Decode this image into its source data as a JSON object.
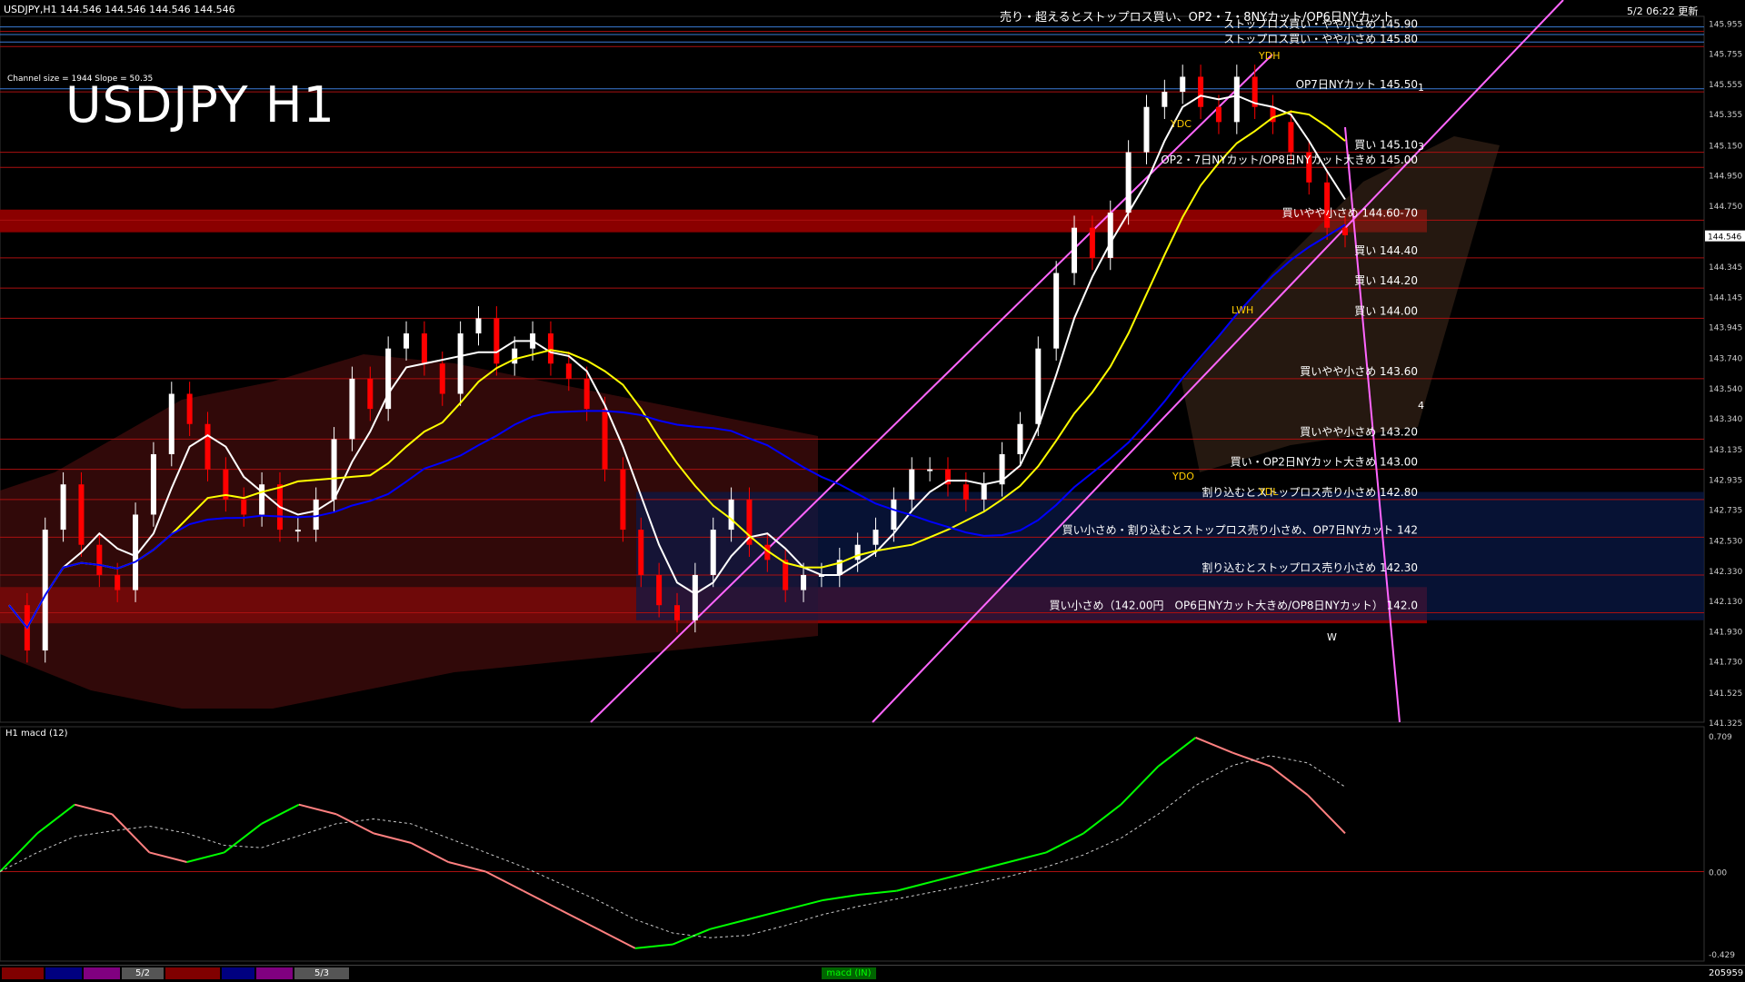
{
  "header": {
    "symbol_line": "USDJPY,H1  144.546 144.546 144.546 144.546",
    "datetime": "5/2 06:22 更新",
    "channel_info": "Channel size = 1944 Slope = 50.35",
    "chart_title": "USDJPY H1",
    "macd_label": "H1  macd (12)"
  },
  "colors": {
    "background": "#000000",
    "up_candle": "#ffffff",
    "down_candle": "#ff0000",
    "sma_short": "#ffffff",
    "sma_mid": "#ffff00",
    "sma_long": "#0000ff",
    "macd_up": "#00ff00",
    "macd_down": "#ff8080",
    "channel": "#ff66ff",
    "zone": "#8b0000"
  },
  "chart_data": {
    "type": "candlestick",
    "price_axis": {
      "min": 141.325,
      "max": 146.0,
      "ticks": [
        "145.955",
        "145.755",
        "145.555",
        "145.355",
        "145.150",
        "144.950",
        "144.750",
        "144.546",
        "144.345",
        "144.145",
        "143.945",
        "143.740",
        "143.540",
        "143.340",
        "143.135",
        "142.935",
        "142.735",
        "142.530",
        "142.330",
        "142.130",
        "141.930",
        "141.730",
        "141.525",
        "141.325"
      ],
      "current_price": "144.546"
    },
    "levels": [
      {
        "price": 145.9,
        "label": "ストップロス買い・やや小さめ 145.90"
      },
      {
        "price": 145.8,
        "label": "ストップロス買い・やや小さめ 145.80"
      },
      {
        "price": 145.5,
        "label": "OP7日NYカット 145.50"
      },
      {
        "price": 145.1,
        "label": "買い 145.10"
      },
      {
        "price": 145.0,
        "label": "OP2・7日NYカット/OP8日NYカット大きめ 145.00"
      },
      {
        "price": 144.65,
        "label": "買いやや小さめ 144.60-70"
      },
      {
        "price": 144.4,
        "label": "買い 144.40"
      },
      {
        "price": 144.2,
        "label": "買い 144.20"
      },
      {
        "price": 144.0,
        "label": "買い 144.00"
      },
      {
        "price": 143.6,
        "label": "買いやや小さめ 143.60"
      },
      {
        "price": 143.2,
        "label": "買いやや小さめ 143.20"
      },
      {
        "price": 143.0,
        "label": "買い・OP2日NYカット大きめ 143.00"
      },
      {
        "price": 142.8,
        "label": "割り込むとストップロス売り小さめ 142.80"
      },
      {
        "price": 142.55,
        "label": "買い小さめ・割り込むとストップロス売り小さめ、OP7日NYカット 142"
      },
      {
        "price": 142.3,
        "label": "割り込むとストップロス売り小さめ 142.30"
      },
      {
        "price": 142.05,
        "label": "買い小さめ（142.00円　OP6日NYカット大きめ/OP8日NYカット） 142.0"
      }
    ],
    "top_note": "売り・超えるとストップロス買い、OP2・7・8NYカット/OP6日NYカット",
    "markers": [
      "YDH",
      "YDC",
      "YDO",
      "YDL",
      "LWH",
      "W",
      "1",
      "3",
      "4"
    ],
    "macd_axis": {
      "max": "0.709",
      "zero": "0.00",
      "min": "-0.429"
    },
    "volume_label": "205959"
  },
  "tabs": [
    "",
    "",
    "",
    "5/2",
    "",
    "",
    "",
    "5/3"
  ],
  "bottom_label": "macd (IN)"
}
